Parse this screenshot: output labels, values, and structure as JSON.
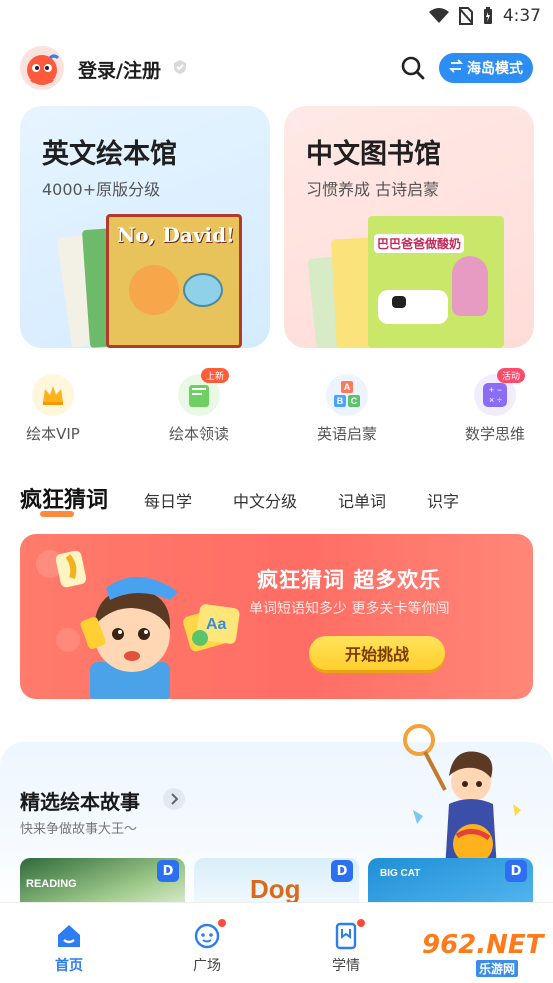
{
  "status_bar": {
    "time": "4:37"
  },
  "header": {
    "login_label": "登录/注册",
    "mode_button": "海岛模式"
  },
  "cards": [
    {
      "title": "英文绘本馆",
      "subtitle": "4000+原版分级",
      "book_cover": "No, David!"
    },
    {
      "title": "中文图书馆",
      "subtitle": "习惯养成 古诗启蒙",
      "book_cover": "巴巴爸爸做酸奶"
    }
  ],
  "quick_entries": [
    {
      "label": "绘本VIP",
      "icon": "crown-icon",
      "badge": ""
    },
    {
      "label": "绘本领读",
      "icon": "book-icon",
      "badge": "上新"
    },
    {
      "label": "英语启蒙",
      "icon": "abc-blocks-icon",
      "badge": ""
    },
    {
      "label": "数学思维",
      "icon": "calculator-icon",
      "badge": "活动"
    }
  ],
  "tabs": [
    "疯狂猜词",
    "每日学",
    "中文分级",
    "记单词",
    "识字"
  ],
  "banner": {
    "title": "疯狂猜词 超多欢乐",
    "subtitle": "单词短语知多少 更多关卡等你闯",
    "button": "开始挑战",
    "card_text": "Aa"
  },
  "section": {
    "title": "精选绘本故事",
    "subtitle": "快来争做故事大王～",
    "stories": [
      {
        "cover_text": "READING",
        "badge": "D"
      },
      {
        "cover_text": "Dog",
        "badge": "D"
      },
      {
        "cover_text": "BIG CAT",
        "badge": "D"
      }
    ]
  },
  "bottom_nav": [
    {
      "label": "首页",
      "active": true
    },
    {
      "label": "广场",
      "active": false
    },
    {
      "label": "学情",
      "active": false
    }
  ],
  "watermark": {
    "main": "962.NET",
    "sub": "乐游网"
  },
  "colors": {
    "accent": "#2c8df3",
    "tab_underline": "#ff8a3d",
    "banner": "#ff6d64",
    "button_yellow": "#ffd43a"
  }
}
